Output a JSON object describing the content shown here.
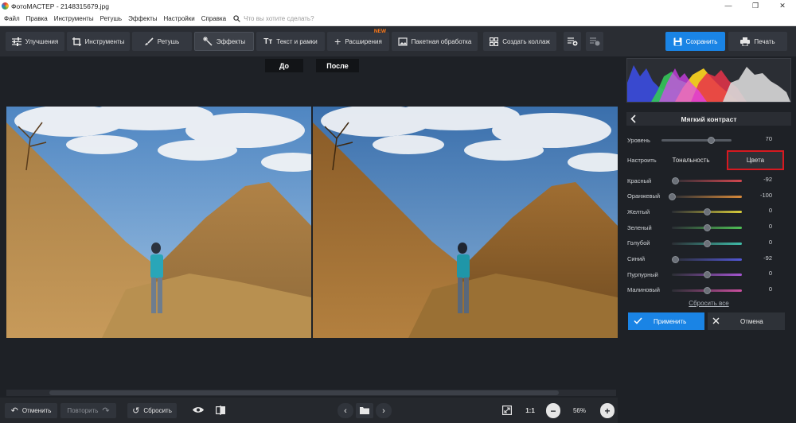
{
  "window": {
    "title": "ФотоМАСТЕР - 2148315679.jpg"
  },
  "menu": {
    "items": [
      "Файл",
      "Правка",
      "Инструменты",
      "Ретушь",
      "Эффекты",
      "Настройки",
      "Справка"
    ],
    "search_placeholder": "Что вы хотите сделать?"
  },
  "toolbar": {
    "improvements": "Улучшения",
    "tools": "Инструменты",
    "retouch": "Ретушь",
    "effects": "Эффекты",
    "text_frames": "Текст и рамки",
    "extensions": "Расширения",
    "new_badge": "NEW",
    "batch": "Пакетная обработка",
    "collage": "Создать коллаж",
    "save": "Сохранить",
    "print": "Печать"
  },
  "view": {
    "before": "До",
    "after": "После"
  },
  "bottom": {
    "undo": "Отменить",
    "redo": "Повторить",
    "reset": "Сбросить",
    "ratio": "1:1",
    "zoom": "56%"
  },
  "panel": {
    "title": "Мягкий контраст",
    "level_label": "Уровень",
    "level_value": "70",
    "level_fraction": 0.7,
    "configure_label": "Настроить",
    "tab_tonality": "Тональность",
    "tab_colors": "Цвета",
    "colors": [
      {
        "name": "Красный",
        "value": "-92",
        "v": -92,
        "color": "#d2474f"
      },
      {
        "name": "Оранжевый",
        "value": "-100",
        "v": -100,
        "color": "#d98a3a"
      },
      {
        "name": "Желтый",
        "value": "0",
        "v": 0,
        "color": "#d8cc3a"
      },
      {
        "name": "Зеленый",
        "value": "0",
        "v": 0,
        "color": "#4fbf55"
      },
      {
        "name": "Голубой",
        "value": "0",
        "v": 0,
        "color": "#3fbca8"
      },
      {
        "name": "Синий",
        "value": "-92",
        "v": -92,
        "color": "#5257d6"
      },
      {
        "name": "Пурпурный",
        "value": "0",
        "v": 0,
        "color": "#a455d0"
      },
      {
        "name": "Малиновый",
        "value": "0",
        "v": 0,
        "color": "#cc4fa0"
      }
    ],
    "reset_all": "Сбросить все",
    "apply": "Применить",
    "cancel": "Отмена"
  },
  "colors": {
    "accent": "#1a84e5",
    "highlight": "#d71920",
    "badge": "#ff7a1a"
  }
}
